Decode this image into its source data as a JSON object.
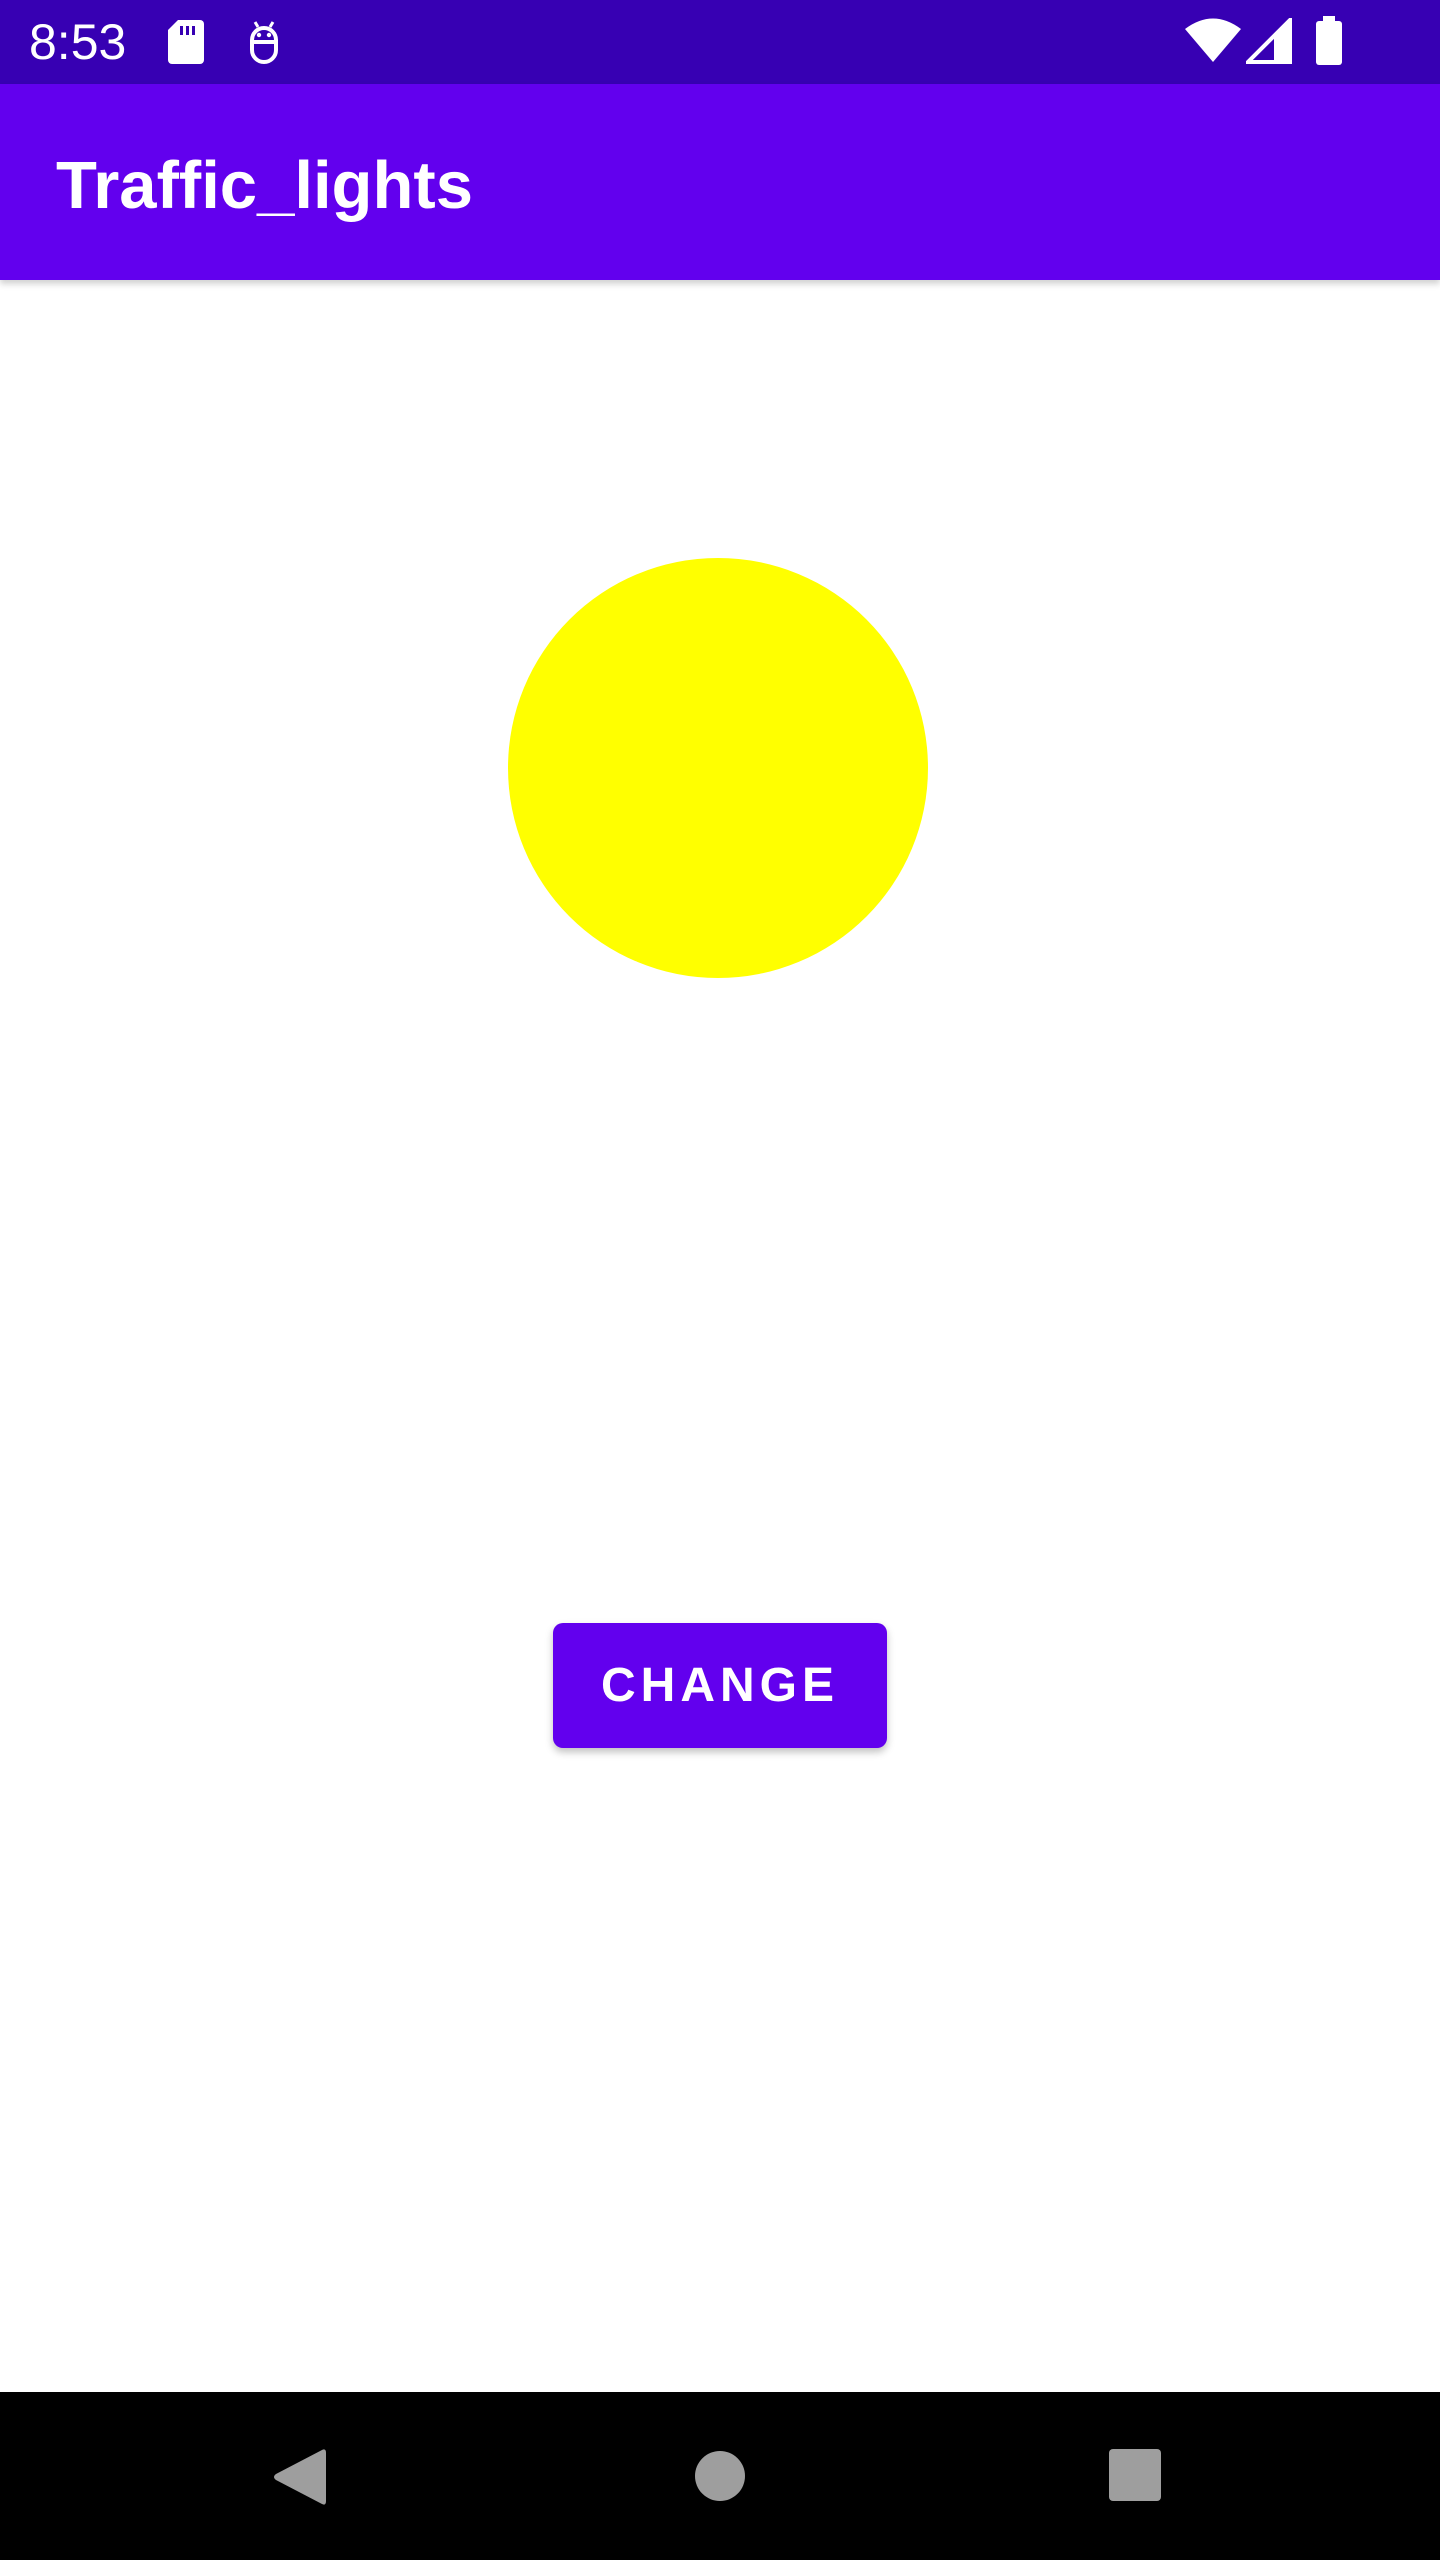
{
  "status_bar": {
    "time": "8:53",
    "icons": [
      "sd-card-icon",
      "android-debug-icon",
      "wifi-icon",
      "cell-signal-icon",
      "battery-icon"
    ],
    "background": "#3700b3"
  },
  "app_bar": {
    "title": "Traffic_lights",
    "background": "#6200ee"
  },
  "traffic_light": {
    "current_color": "#ffff00"
  },
  "change_button": {
    "label": "CHANGE",
    "background": "#6200ee"
  },
  "nav_bar": {
    "buttons": [
      "back-icon",
      "home-icon",
      "recents-icon"
    ],
    "background": "#000000"
  }
}
